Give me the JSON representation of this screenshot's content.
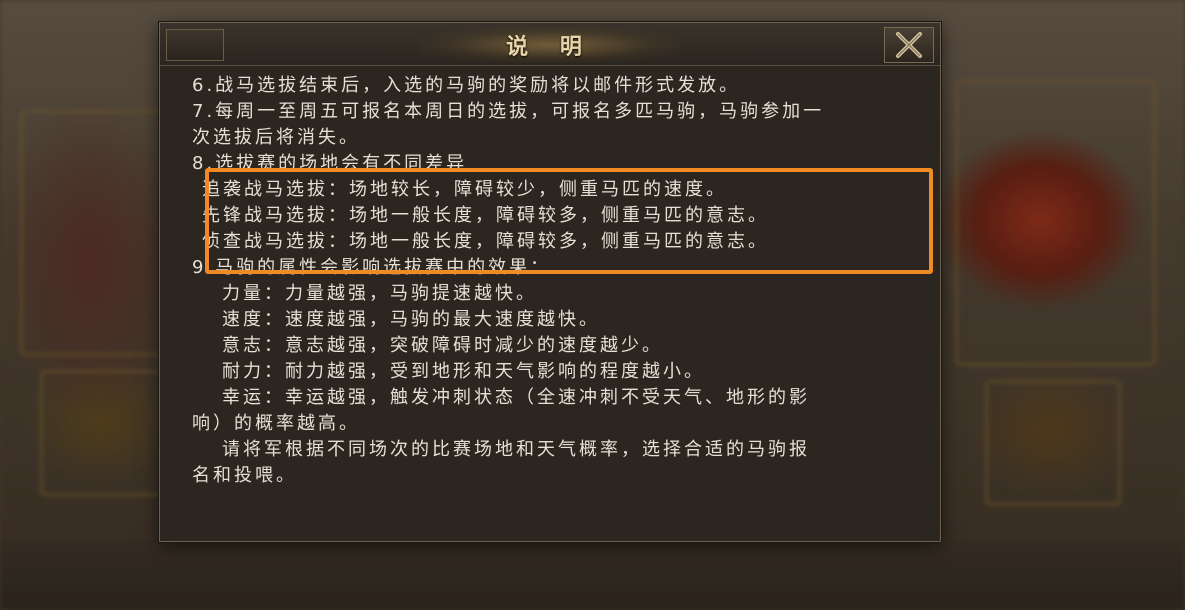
{
  "dialog": {
    "title": "说 明",
    "lines": [
      "6.战马选拔结束后，入选的马驹的奖励将以邮件形式发放。",
      "7.每周一至周五可报名本周日的选拔，可报名多匹马驹，马驹参加一",
      "次选拔后将消失。",
      "8.选拔赛的场地会有不同差异",
      "追袭战马选拔：场地较长，障碍较少，侧重马匹的速度。",
      "先锋战马选拔：场地一般长度，障碍较多，侧重马匹的意志。",
      "侦查战马选拔：场地一般长度，障碍较多，侧重马匹的意志。",
      "9.马驹的属性会影响选拔赛中的效果：",
      "力量：力量越强，马驹提速越快。",
      "速度：速度越强，马驹的最大速度越快。",
      "意志：意志越强，突破障碍时减少的速度越少。",
      "耐力：耐力越强，受到地形和天气影响的程度越小。",
      "幸运：幸运越强，触发冲刺状态（全速冲刺不受天气、地形的影",
      "响）的概率越高。",
      "请将军根据不同场次的比赛场地和天气概率，选择合适的马驹报",
      "名和投喂。"
    ]
  },
  "icons": {
    "close": "close-x-icon"
  },
  "colors": {
    "highlight": "#f08a24",
    "text": "#e6e0d4",
    "title": "#e8d5a8"
  }
}
